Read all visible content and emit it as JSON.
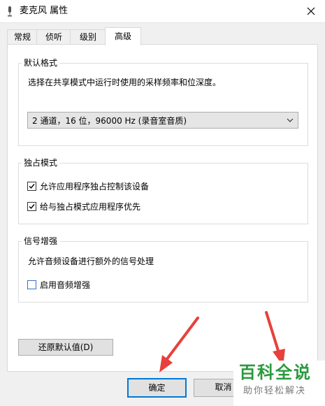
{
  "window": {
    "title": "麦克风 属性"
  },
  "tabs": [
    {
      "label": "常规"
    },
    {
      "label": "侦听"
    },
    {
      "label": "级别"
    },
    {
      "label": "高级",
      "active": true
    }
  ],
  "default_format": {
    "legend": "默认格式",
    "description": "选择在共享模式中运行时使用的采样频率和位深度。",
    "selected": "2 通道，16 位，96000 Hz (录音室音质)"
  },
  "exclusive_mode": {
    "legend": "独占模式",
    "options": [
      {
        "label": "允许应用程序独占控制该设备",
        "checked": true
      },
      {
        "label": "给与独占模式应用程序优先",
        "checked": true
      }
    ]
  },
  "signal_enhancement": {
    "legend": "信号增强",
    "description": "允许音频设备进行额外的信号处理",
    "option": {
      "label": "启用音频增强",
      "checked": false
    }
  },
  "buttons": {
    "restore_defaults": "还原默认值(D)",
    "ok": "确定",
    "cancel": "取消"
  },
  "watermark": {
    "main": "百科全说",
    "sub": "助你轻松解决"
  },
  "colors": {
    "accent": "#0078d7",
    "annotation_arrow": "#e8403a",
    "watermark_green": "#2a9a3d"
  }
}
